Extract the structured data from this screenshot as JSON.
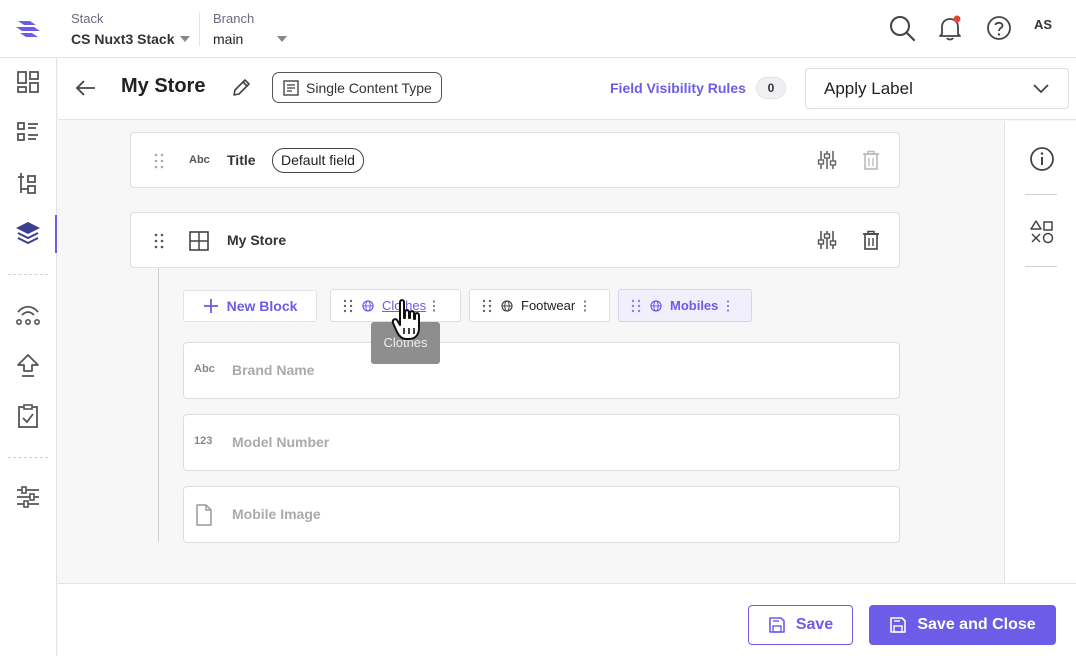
{
  "header": {
    "stack_label": "Stack",
    "stack_value": "CS Nuxt3 Stack",
    "branch_label": "Branch",
    "branch_value": "main",
    "avatar_initials": "AS"
  },
  "subheader": {
    "title": "My Store",
    "content_type_button": "Single Content Type",
    "field_visibility_label": "Field Visibility Rules",
    "field_visibility_count": "0",
    "apply_label": "Apply Label"
  },
  "fields": {
    "title_field": {
      "type_badge": "Abc",
      "name": "Title",
      "pill": "Default field"
    },
    "group_field": {
      "name": "My Store"
    }
  },
  "blocks": {
    "new_block_label": "New Block",
    "tabs": [
      {
        "label": "Clothes"
      },
      {
        "label": "Footwear"
      },
      {
        "label": "Mobiles"
      }
    ],
    "tooltip": "Clothes"
  },
  "subfields": [
    {
      "type_badge": "Abc",
      "name": "Brand Name"
    },
    {
      "type_badge": "123",
      "name": "Model Number"
    },
    {
      "type_badge": "",
      "name": "Mobile Image"
    }
  ],
  "footer": {
    "save_label": "Save",
    "save_close_label": "Save and Close"
  },
  "colors": {
    "accent": "#6c5ce7",
    "notification_dot": "#e0463a"
  }
}
